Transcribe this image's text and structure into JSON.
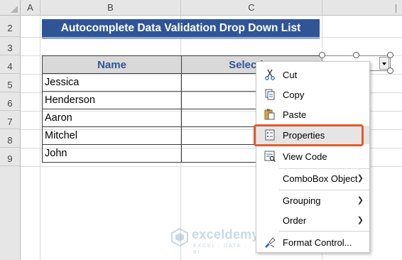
{
  "columns": [
    "A",
    "B",
    "C"
  ],
  "rows": [
    "2",
    "3",
    "4",
    "5",
    "6",
    "7",
    "8",
    "9"
  ],
  "title": "Autocomplete Data Validation Drop Down List",
  "table": {
    "headers": [
      "Name",
      "Selection"
    ],
    "names": [
      "Jessica",
      "Henderson",
      "Aaron",
      "Mitchel",
      "John"
    ]
  },
  "context_menu": {
    "items": [
      {
        "label": "Cut",
        "icon": "scissors-icon"
      },
      {
        "label": "Copy",
        "icon": "copy-icon"
      },
      {
        "label": "Paste",
        "icon": "paste-icon"
      },
      {
        "label": "Properties",
        "icon": "properties-icon",
        "highlighted": true
      },
      {
        "label": "View Code",
        "icon": "view-code-icon"
      },
      {
        "label": "ComboBox Object",
        "submenu": true
      },
      {
        "label": "Grouping",
        "submenu": true
      },
      {
        "label": "Order",
        "submenu": true
      },
      {
        "label": "Format Control...",
        "icon": "format-control-icon"
      }
    ]
  },
  "highlight_color": "#e15b2d",
  "header_color": "#2f5597",
  "watermark": {
    "name": "exceldemy",
    "tagline": "EXCEL · DATA · BI"
  }
}
